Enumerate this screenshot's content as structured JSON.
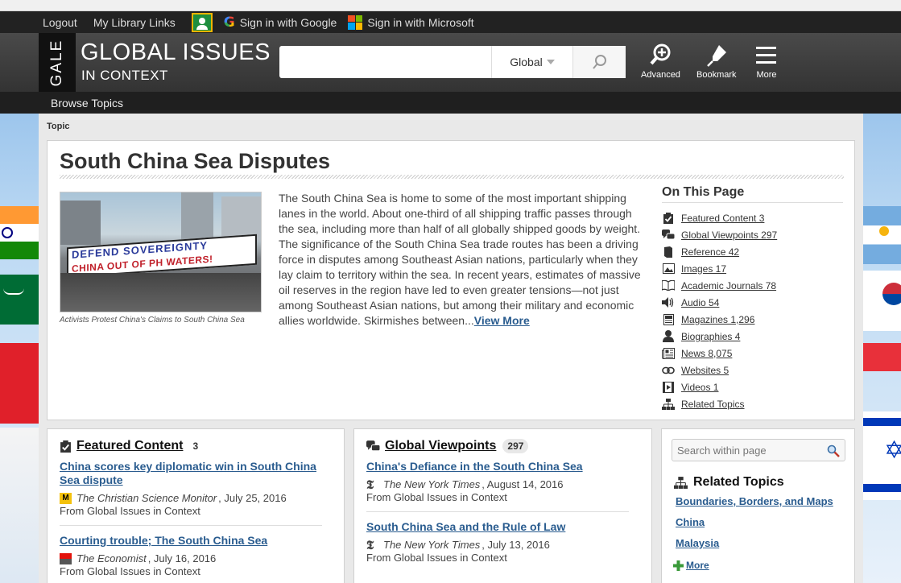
{
  "topbar": {
    "logout": "Logout",
    "library_links": "My Library Links",
    "google_signin": "Sign in with Google",
    "microsoft_signin": "Sign in with Microsoft"
  },
  "header": {
    "gale": "GALE",
    "title": "GLOBAL ISSUES",
    "subtitle": "IN CONTEXT",
    "search_value": "",
    "scope": "Global",
    "tools": [
      {
        "label": "Advanced",
        "icon": "advanced-search-icon"
      },
      {
        "label": "Bookmark",
        "icon": "bookmark-icon"
      },
      {
        "label": "More",
        "icon": "hamburger-menu-icon"
      }
    ]
  },
  "nav": {
    "browse_topics": "Browse Topics"
  },
  "page": {
    "label": "Topic",
    "title": "South China Sea Disputes",
    "image": {
      "banner_line1": "DEFEND SOVEREIGNTY",
      "banner_line2": "CHINA OUT OF PH WATERS!",
      "caption": "Activists Protest China's Claims to South China Sea"
    },
    "summary": "The South China Sea is home to some of the most important shipping lanes in the world. About one-third of all shipping traffic passes through the sea, including more than half of all globally shipped goods by weight. The significance of the South China Sea trade routes has been a driving force in disputes among Southeast Asian nations, particularly when they lay claim to territory within the sea. In recent years, estimates of massive oil reserves in the region have led to even greater tensions—not just among Southeast Asian nations, but among their military and economic allies worldwide. Skirmishes between...",
    "view_more": "View More"
  },
  "on_this_page": {
    "title": "On This Page",
    "items": [
      {
        "label": "Featured Content 3",
        "icon": "clipboard-check-icon"
      },
      {
        "label": "Global Viewpoints 297",
        "icon": "speech-bubbles-icon"
      },
      {
        "label": "Reference 42",
        "icon": "reference-book-icon"
      },
      {
        "label": "Images 17",
        "icon": "image-icon"
      },
      {
        "label": "Academic Journals 78",
        "icon": "open-book-icon"
      },
      {
        "label": "Audio 54",
        "icon": "speaker-icon"
      },
      {
        "label": "Magazines 1,296",
        "icon": "magazine-icon"
      },
      {
        "label": "Biographies 4",
        "icon": "person-icon"
      },
      {
        "label": "News 8,075",
        "icon": "newspaper-icon"
      },
      {
        "label": "Websites 5",
        "icon": "link-icon"
      },
      {
        "label": "Videos 1",
        "icon": "video-icon"
      },
      {
        "label": "Related Topics",
        "icon": "hierarchy-icon"
      }
    ]
  },
  "featured": {
    "title": "Featured Content",
    "count": "3",
    "items": [
      {
        "title": "China scores key diplomatic win in South China Sea dispute",
        "source": "The Christian Science Monitor",
        "date": ", July 25, 2016",
        "from": "From Global Issues in Context",
        "color": "#f4c20d"
      },
      {
        "title": "Courting trouble; The South China Sea",
        "source": "The Economist",
        "date": ", July 16, 2016",
        "from": "From Global Issues in Context",
        "color": "#e3120b"
      }
    ]
  },
  "viewpoints": {
    "title": "Global Viewpoints",
    "count": "297",
    "items": [
      {
        "title": "China's Defiance in the South China Sea",
        "source": "The New York Times",
        "date": ", August 14, 2016",
        "from": "From Global Issues in Context"
      },
      {
        "title": "South China Sea and the Rule of Law",
        "source": "The New York Times",
        "date": ", July 13, 2016",
        "from": "From Global Issues in Context"
      }
    ]
  },
  "sidebar": {
    "search_placeholder": "Search within page",
    "related_title": "Related Topics",
    "related": [
      "Boundaries, Borders, and Maps",
      "China",
      "Malaysia"
    ],
    "more": "More"
  }
}
